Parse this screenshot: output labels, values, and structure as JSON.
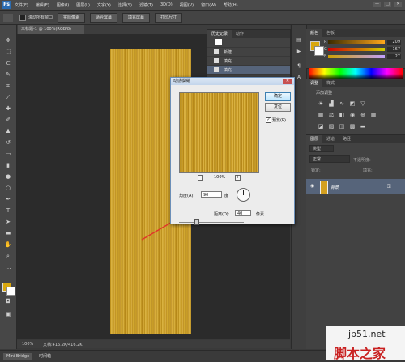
{
  "app": {
    "logo": "Ps"
  },
  "menu": [
    "文件(F)",
    "编辑(E)",
    "图像(I)",
    "图层(L)",
    "文字(Y)",
    "选择(S)",
    "滤镜(T)",
    "3D(D)",
    "视图(V)",
    "窗口(W)",
    "帮助(H)"
  ],
  "window_controls": [
    "—",
    "□",
    "✕"
  ],
  "options_bar": {
    "checkbox_label": "滚动所有窗口",
    "buttons": [
      "实际像素",
      "适合屏幕",
      "填充屏幕",
      "打印尺寸"
    ]
  },
  "document": {
    "tab_title": "未标题-1 @ 100%(RGB/8)"
  },
  "status": {
    "zoom": "100%",
    "doc_info": "文档:416.2K/416.2K"
  },
  "bottom_tabs": [
    "Mini Bridge",
    "时间轴"
  ],
  "history_panel": {
    "tabs": [
      "历史记录",
      "动作"
    ],
    "items": [
      "新建",
      "填充",
      "填充"
    ]
  },
  "color_panel": {
    "tabs": [
      "颜色",
      "色板"
    ],
    "channels": [
      {
        "label": "R",
        "value": "209",
        "color": "#e03030"
      },
      {
        "label": "G",
        "value": "167",
        "color": "#30c030"
      },
      {
        "label": "B",
        "value": "27",
        "color": "#3050e0"
      }
    ]
  },
  "adjustments_panel": {
    "tabs": [
      "调整",
      "样式"
    ],
    "title": "添加调整"
  },
  "layers_panel": {
    "tabs": [
      "图层",
      "通道",
      "路径"
    ],
    "filter": "类型",
    "blend_mode": "正常",
    "opacity_label": "不透明度:",
    "lock_label": "锁定:",
    "fill_label": "填充:",
    "layer": {
      "name": "背景"
    }
  },
  "dialog": {
    "title": "动感模糊",
    "ok": "确定",
    "reset": "复位",
    "preview_label": "预览(P)",
    "preview_checked": "✓",
    "zoom_minus": "−",
    "zoom_plus": "+",
    "zoom": "100%",
    "angle_label": "角度(A):",
    "angle_value": "90",
    "angle_unit": "度",
    "distance_label": "距离(D):",
    "distance_value": "40",
    "distance_unit": "像素"
  },
  "watermark": {
    "url": "jb51.net",
    "text": "脚本之家"
  },
  "colors": {
    "accent": "#d9a70e",
    "selection": "#56647a",
    "arrow": "#e0362a"
  }
}
